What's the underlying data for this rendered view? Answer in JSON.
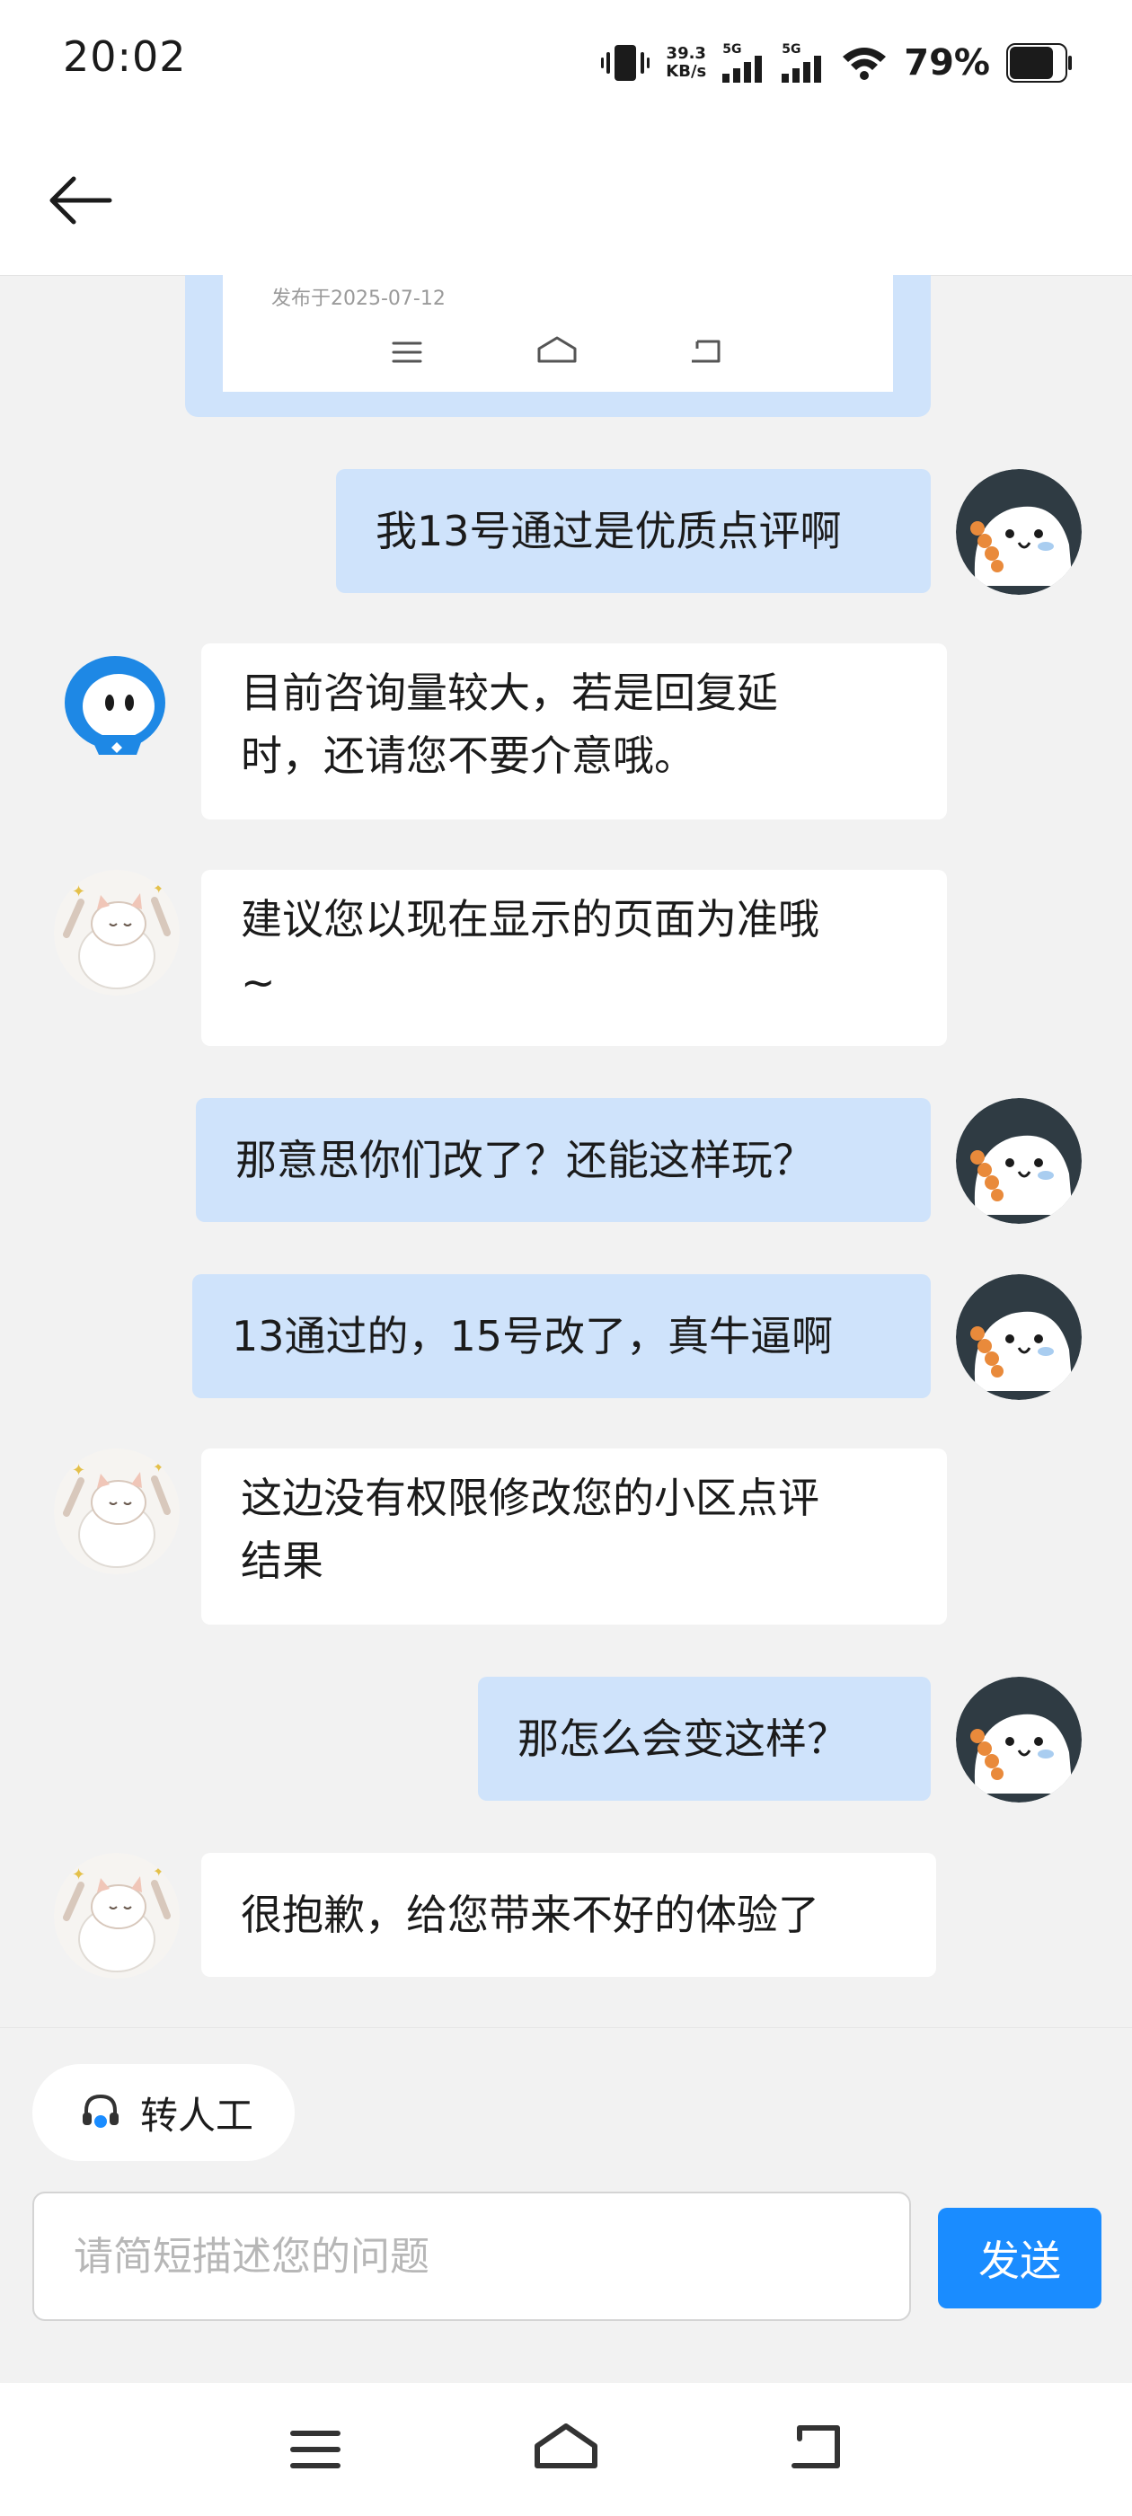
{
  "status_bar": {
    "time": "20:02",
    "net_speed_value": "39.3",
    "net_speed_unit": "KB/s",
    "sim1_label": "5G",
    "sim2_label": "5G",
    "battery": "79%"
  },
  "card": {
    "date_text": "发布于2025-07-12"
  },
  "messages": [
    {
      "side": "user",
      "text": "我13号通过是优质点评啊"
    },
    {
      "side": "agent",
      "avatar": "robot",
      "text": "目前咨询量较大，若是回复延\n时，还请您不要介意哦。"
    },
    {
      "side": "agent",
      "avatar": "cat",
      "text": "建议您以现在显示的页面为准哦\n~"
    },
    {
      "side": "user",
      "text": "那意思你们改了？还能这样玩？"
    },
    {
      "side": "user",
      "text": "13通过的，15号改了，真牛逼啊"
    },
    {
      "side": "agent",
      "avatar": "cat",
      "text": "这边没有权限修改您的小区点评\n结果"
    },
    {
      "side": "user",
      "text": "那怎么会变这样？"
    },
    {
      "side": "agent",
      "avatar": "cat",
      "text": "很抱歉，给您带来不好的体验了"
    }
  ],
  "bottom": {
    "transfer_label": "转人工",
    "input_placeholder": "请简短描述您的问题",
    "input_value": "",
    "send_label": "发送"
  },
  "icons": {
    "back": "arrow-left-icon",
    "transfer": "headset-icon",
    "nav_menu": "menu-icon",
    "nav_home": "home-icon",
    "nav_back": "return-icon"
  },
  "colors": {
    "user_bubble": "#cfe3fb",
    "agent_bubble": "#ffffff",
    "send_button": "#1a8cff",
    "chat_background": "#f2f2f2"
  }
}
